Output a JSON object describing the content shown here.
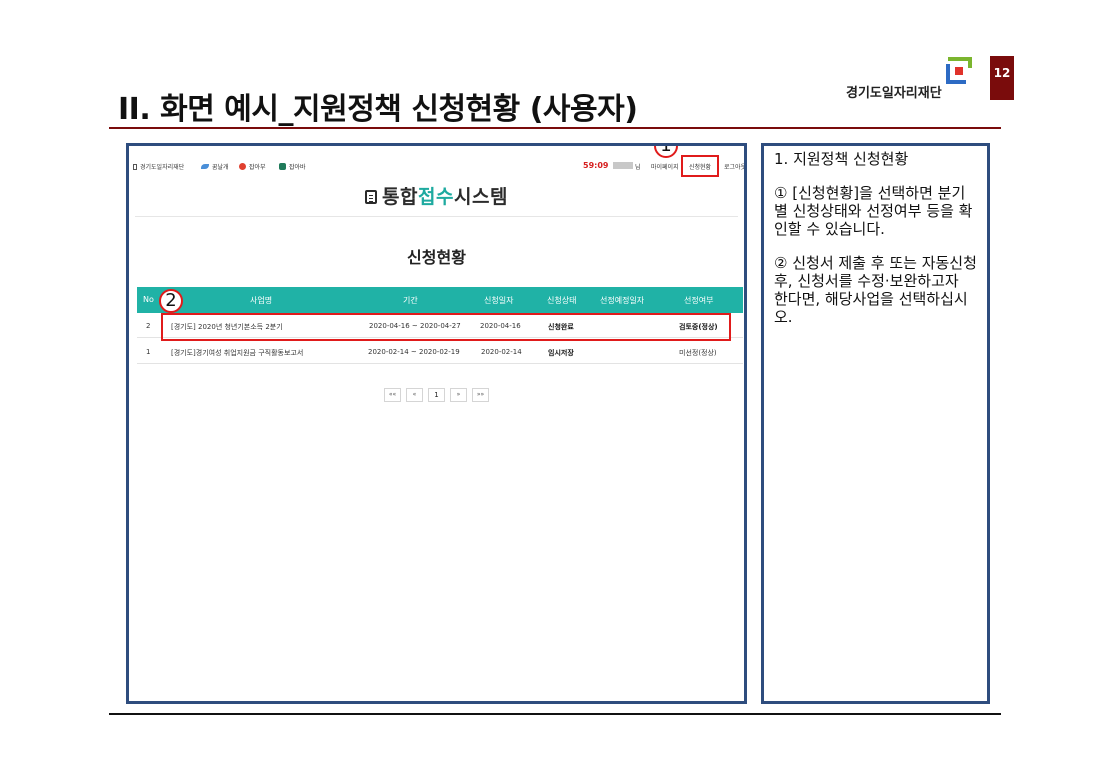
{
  "slide": {
    "title": "II. 화면 예시_지원정책 신청현황 (사용자)",
    "page_number": "12",
    "brand_name": "경기도일자리재단",
    "accent_color": "#7a0c0c"
  },
  "screen": {
    "topbar": {
      "items": [
        {
          "label": "경기도일자리재단",
          "icon": "building-icon"
        },
        {
          "label": "꿈날개",
          "icon": "wing-icon"
        },
        {
          "label": "잡아부",
          "icon": "red-circle-icon"
        },
        {
          "label": "잡아바",
          "icon": "green-icon"
        }
      ],
      "timer": "59:09",
      "user_suffix": "님",
      "mypage": "마이페이지",
      "apply_status": "신청현황",
      "logout": "로그아웃"
    },
    "logo": {
      "part1": "통합",
      "part2": "접수",
      "part3": "시스템"
    },
    "section_title": "신청현황",
    "table": {
      "headers": [
        "No",
        "사업명",
        "기간",
        "신청일자",
        "신청상태",
        "선정예정일자",
        "선정여부"
      ],
      "rows": [
        {
          "no": "2",
          "name": "[경기도] 2020년 청년기본소득 2분기",
          "period": "2020-04-16 ~ 2020-04-27",
          "date": "2020-04-16",
          "status": "신청완료",
          "expected": "",
          "result": "검토중(정상)"
        },
        {
          "no": "1",
          "name": "[경기도]경기여성 취업지원금 구직활동보고서",
          "period": "2020-02-14 ~ 2020-02-19",
          "date": "2020-02-14",
          "status": "임시저장",
          "expected": "",
          "result": "미선정(정상)"
        }
      ]
    },
    "pager": {
      "first": "««",
      "prev": "«",
      "current": "1",
      "next": "»",
      "last": "»»"
    },
    "markers": {
      "m1": "1",
      "m2": "2"
    },
    "highlight_color": "#e01b1b",
    "table_color": "#20b2a6"
  },
  "description": {
    "heading": "1.  지원정책 신청현황",
    "p1": "① [신청현황]을 선택하면 분기별 신청상태와 선정여부 등을 확인할 수 있습니다.",
    "p2": "② 신청서 제출 후 또는 자동신청 후, 신청서를 수정·보완하고자 한다면, 해당사업을 선택하십시오."
  }
}
